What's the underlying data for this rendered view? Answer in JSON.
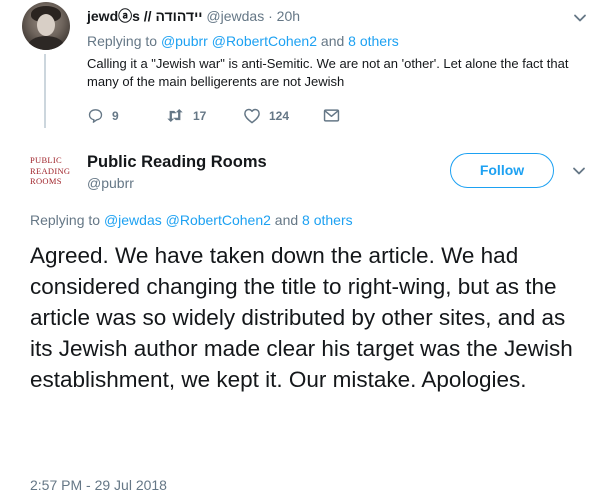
{
  "parent_tweet": {
    "display_name": "jewdⓐs // יידהודה",
    "handle": "@jewdas",
    "separator": "·",
    "time": "20h",
    "replying_to_prefix": "Replying to",
    "replying_to_users": [
      "@pubrr",
      "@RobertCohen2"
    ],
    "replying_to_and": "and",
    "replying_to_others": "8 others",
    "text": "Calling it a \"Jewish war\" is anti-Semitic. We are not an 'other'. Let alone the fact that many of the main belligerents are not Jewish",
    "actions": {
      "reply_count": "9",
      "retweet_count": "17",
      "like_count": "124"
    }
  },
  "main_tweet": {
    "logo_lines": [
      "PUBLIC",
      "READING",
      "ROOMS"
    ],
    "display_name": "Public Reading Rooms",
    "handle": "@pubrr",
    "follow_label": "Follow",
    "replying_to_prefix": "Replying to",
    "replying_to_users": [
      "@jewdas",
      "@RobertCohen2"
    ],
    "replying_to_and": "and",
    "replying_to_others": "8 others",
    "text": "Agreed. We have taken down the article. We had considered changing the title to right-wing, but as the article was so widely distributed by other sites, and as its Jewish author made clear his target was the Jewish establishment, we kept it. Our mistake. Apologies.",
    "timestamp": "2:57 PM - 29 Jul 2018"
  },
  "colors": {
    "accent": "#1da1f2",
    "muted": "#657786",
    "text": "#14171a",
    "logo": "#a0232a"
  },
  "icons": [
    "chevron-down-icon",
    "reply-icon",
    "retweet-icon",
    "heart-icon",
    "envelope-icon"
  ]
}
